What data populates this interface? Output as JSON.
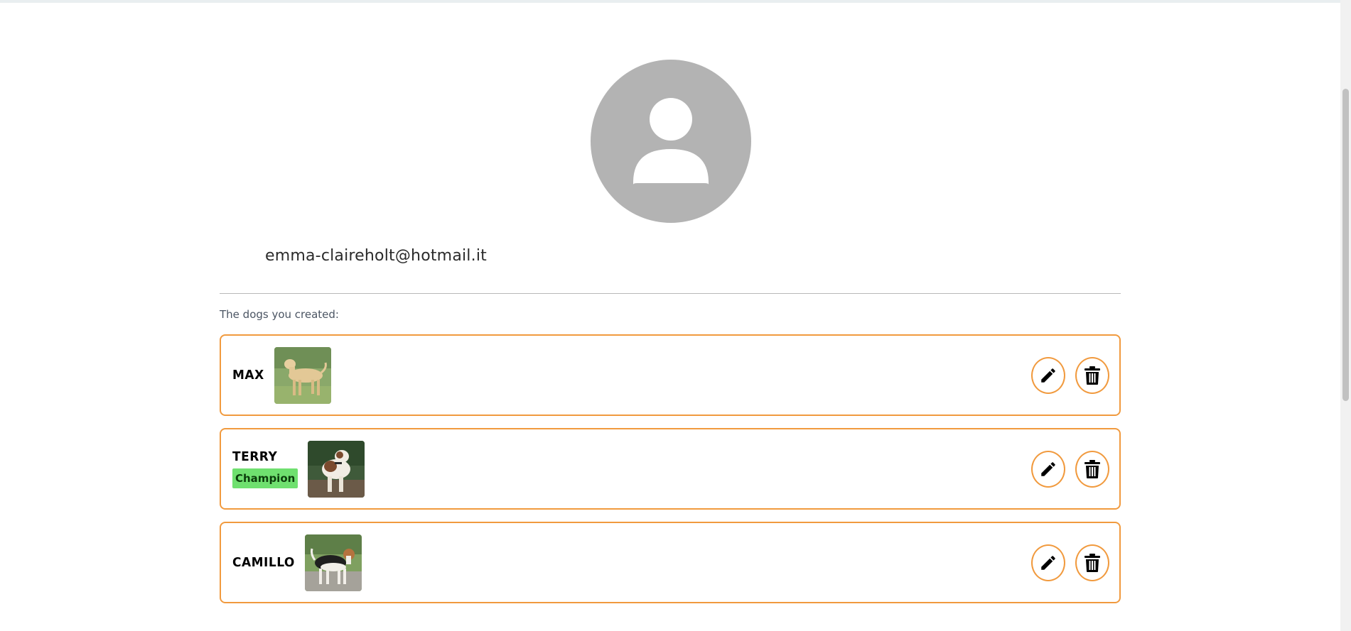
{
  "profile": {
    "email": "emma-claireholt@hotmail.it"
  },
  "section": {
    "label": "The dogs you created:"
  },
  "colors": {
    "accent_border": "#f19a3e",
    "badge_bg": "#6fe06f",
    "avatar_bg": "#b3b3b3"
  },
  "dogs": [
    {
      "name": "MAX",
      "badge": "",
      "photo_icon": "yellow-labrador-photo"
    },
    {
      "name": "TERRY",
      "badge": "Champion",
      "photo_icon": "bulldog-photo"
    },
    {
      "name": "CAMILLO",
      "badge": "",
      "photo_icon": "beagle-photo"
    }
  ],
  "icons": {
    "edit": "pencil-icon",
    "delete": "trash-icon",
    "avatar": "user-icon"
  }
}
